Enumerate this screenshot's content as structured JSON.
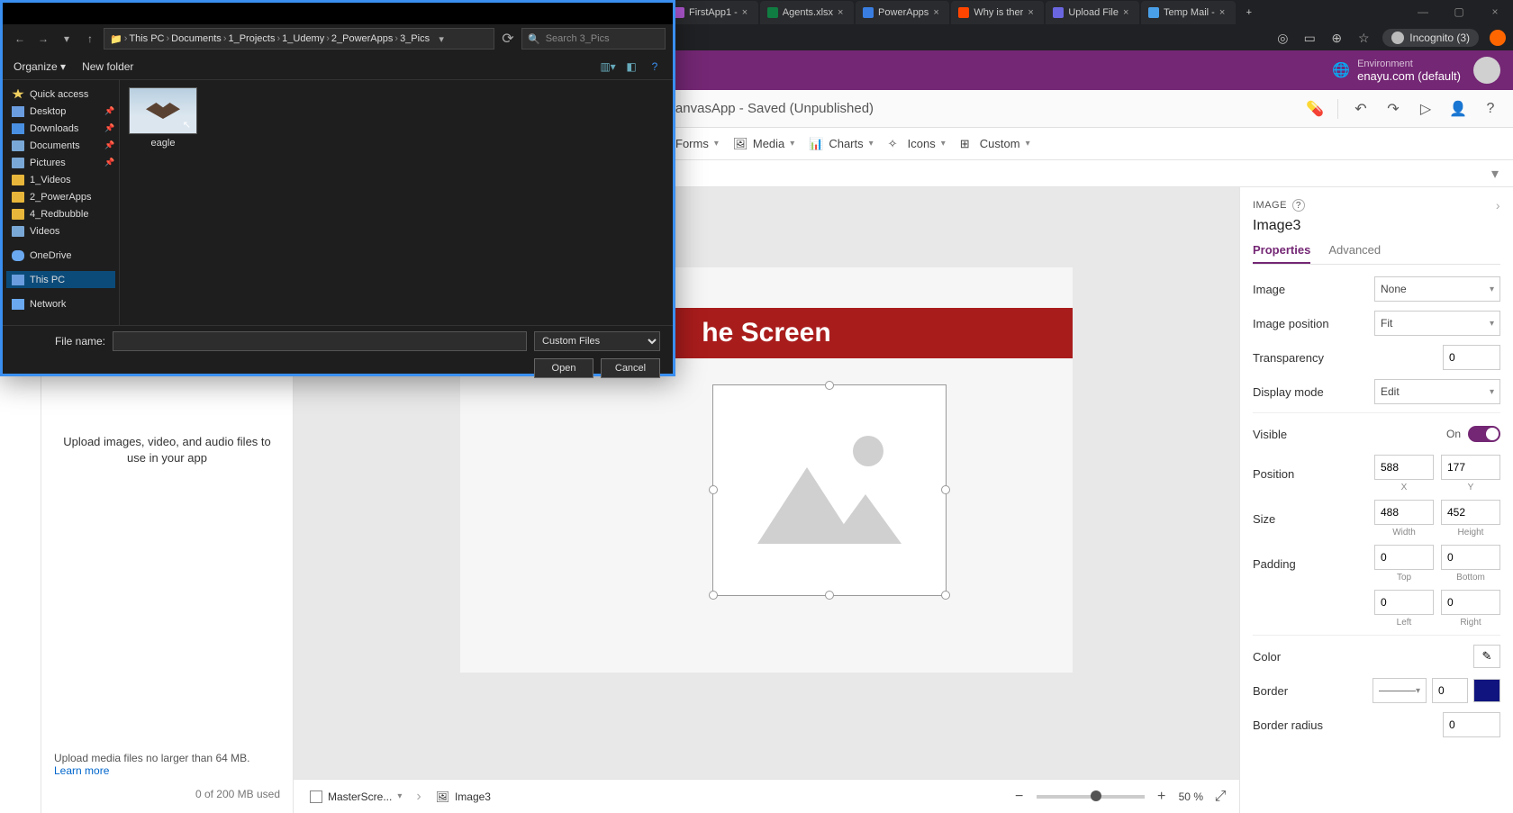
{
  "browser": {
    "tabs": [
      {
        "label": "FirstApp1 -",
        "color": "#aa55cc"
      },
      {
        "label": "Agents.xlsx",
        "color": "#107c41"
      },
      {
        "label": "PowerApps",
        "color": "#3a7de0"
      },
      {
        "label": "Why is ther",
        "color": "#ff4500"
      },
      {
        "label": "Upload File",
        "color": "#6a66e0"
      },
      {
        "label": "Temp Mail -",
        "color": "#4aa0e8"
      }
    ],
    "new": "+",
    "incognito": "Incognito (3)"
  },
  "powerapps": {
    "env_label": "Environment",
    "env_value": "enayu.com (default)",
    "app_title": "FirstCanvasApp - Saved (Unpublished)",
    "ribbon": {
      "forms": "Forms",
      "media": "Media",
      "charts": "Charts",
      "icons": "Icons",
      "custom": "Custom"
    },
    "properties_hdr": "IMAGE",
    "sel_name": "Image3",
    "tabs": {
      "properties": "Properties",
      "advanced": "Advanced"
    },
    "props": {
      "image_lbl": "Image",
      "image_val": "None",
      "imgpos_lbl": "Image position",
      "imgpos_val": "Fit",
      "transp_lbl": "Transparency",
      "transp_val": "0",
      "dispmode_lbl": "Display mode",
      "dispmode_val": "Edit",
      "visible_lbl": "Visible",
      "visible_val": "On",
      "position_lbl": "Position",
      "pos_x": "588",
      "pos_y": "177",
      "x_sub": "X",
      "y_sub": "Y",
      "size_lbl": "Size",
      "size_w": "488",
      "size_h": "452",
      "w_sub": "Width",
      "h_sub": "Height",
      "padding_lbl": "Padding",
      "pad_t": "0",
      "pad_b": "0",
      "pad_l": "0",
      "pad_r": "0",
      "t_sub": "Top",
      "b_sub": "Bottom",
      "l_sub": "Left",
      "r_sub": "Right",
      "color_lbl": "Color",
      "border_lbl": "Border",
      "border_val": "0",
      "bradius_lbl": "Border radius",
      "bradius_val": "0"
    },
    "media_help": "Upload images, video, and audio files to use in your app",
    "media_note": "Upload media files no larger than 64 MB.",
    "media_link": "Learn more",
    "media_used": "0 of 200 MB used",
    "canvas_title": "he Screen",
    "crumb1": "MasterScre...",
    "crumb2": "Image3",
    "zoom": "50",
    "zoom_unit": "%"
  },
  "dialog": {
    "path": [
      "This PC",
      "Documents",
      "1_Projects",
      "1_Udemy",
      "2_PowerApps",
      "3_Pics"
    ],
    "search_ph": "Search 3_Pics",
    "organize": "Organize",
    "newfolder": "New folder",
    "tree": {
      "quick": "Quick access",
      "desktop": "Desktop",
      "downloads": "Downloads",
      "documents": "Documents",
      "pictures": "Pictures",
      "f1": "1_Videos",
      "f2": "2_PowerApps",
      "f3": "4_Redbubble",
      "f4": "Videos",
      "onedrive": "OneDrive",
      "thispc": "This PC",
      "network": "Network"
    },
    "file": "eagle",
    "filename_lbl": "File name:",
    "filename_val": "",
    "filter": "Custom Files",
    "open": "Open",
    "cancel": "Cancel"
  }
}
